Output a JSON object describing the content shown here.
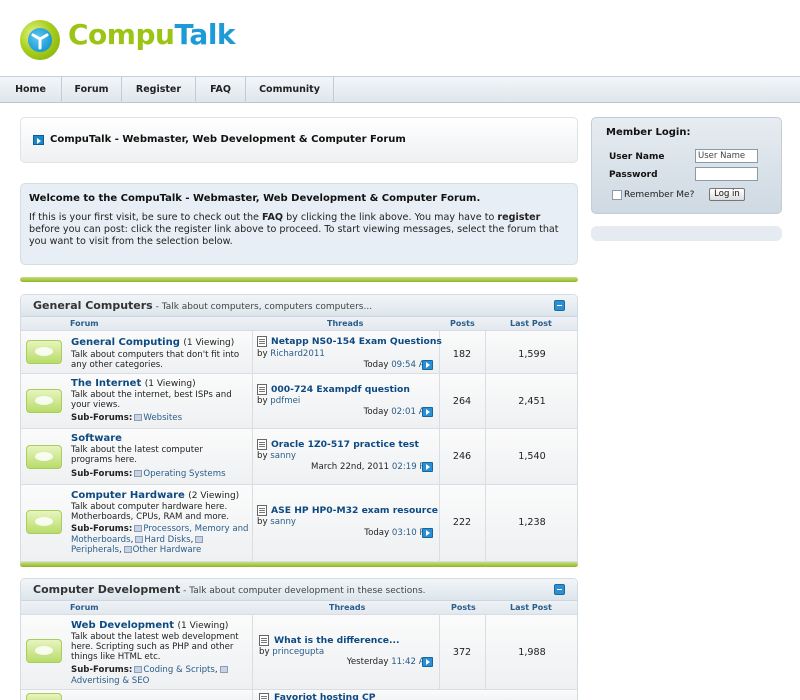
{
  "logo": {
    "part1": "Compu",
    "part2": "Talk"
  },
  "nav": [
    "Home",
    "Forum",
    "Register",
    "FAQ",
    "Community"
  ],
  "page_title": "CompuTalk - Webmaster, Web Development & Computer Forum",
  "welcome": {
    "title": "Welcome to the CompuTalk - Webmaster, Web Development & Computer Forum.",
    "t1": "If this is your first visit, be sure to check out the ",
    "faq": "FAQ",
    "t2": " by clicking the link above. You may have to ",
    "register": "register",
    "t3": " before you can post: click the register link above to proceed. To start viewing messages, select the forum that you want to visit from the selection below."
  },
  "columns": {
    "forum": "Forum",
    "threads": "Threads",
    "posts": "Posts",
    "last_post": "Last Post"
  },
  "subforums_label": "Sub-Forums:",
  "categories": [
    {
      "name": "General Computers",
      "desc": " - Talk about computers, computers computers...",
      "forums": [
        {
          "name": "General Computing",
          "viewing": "(1 Viewing)",
          "desc": "Talk about computers that don't fit into any other categories.",
          "subs": [],
          "thread": "Netapp NS0-154 Exam Questions",
          "by": "by",
          "user": "Richard2011",
          "date": "Today",
          "time": "09:54 AM",
          "threads": "182",
          "posts": "1,599"
        },
        {
          "name": "The Internet",
          "viewing": "(1 Viewing)",
          "desc": "Talk about the internet, best ISPs and your views.",
          "subs": [
            "Websites"
          ],
          "thread": "000-724 Exampdf question",
          "by": "by",
          "user": "pdfmei",
          "date": "Today",
          "time": "02:01 AM",
          "threads": "264",
          "posts": "2,451"
        },
        {
          "name": "Software",
          "viewing": "",
          "desc": "Talk about the latest computer programs here.",
          "subs": [
            "Operating Systems"
          ],
          "thread": "Oracle 1Z0-517 practice test",
          "by": "by",
          "user": "sanny",
          "date": "March 22nd, 2011",
          "time": "02:19 PM",
          "threads": "246",
          "posts": "1,540"
        },
        {
          "name": "Computer Hardware",
          "viewing": "(2 Viewing)",
          "desc": "Talk about computer hardware here. Motherboards, CPUs, RAM and more.",
          "subs": [
            "Processors, Memory and Motherboards",
            "Hard Disks",
            "Peripherals",
            "Other Hardware"
          ],
          "thread": "ASE HP HP0-M32 exam resource",
          "by": "by",
          "user": "sanny",
          "date": "Today",
          "time": "03:10 PM",
          "threads": "222",
          "posts": "1,238"
        }
      ]
    },
    {
      "name": "Computer Development",
      "desc": " - Talk about computer development in these sections.",
      "forums": [
        {
          "name": "Web Development",
          "viewing": "(1 Viewing)",
          "desc": "Talk about the latest web development here. Scripting such as PHP and other things like HTML etc.",
          "subs": [
            "Coding & Scripts",
            "Advertising & SEO"
          ],
          "thread": "What is the difference...",
          "by": "by",
          "user": "princegupta",
          "date": "Yesterday",
          "time": "11:42 AM",
          "threads": "372",
          "posts": "1,988"
        }
      ],
      "next_thread": "Favoriot hosting CP"
    }
  ],
  "login": {
    "title": "Member Login:",
    "user_label": "User Name",
    "user_value": "User Name",
    "pass_label": "Password",
    "remember": "Remember Me?",
    "button": "Log in"
  },
  "colors": {
    "accent_green": "#9cc414",
    "accent_blue": "#1e9ad6",
    "link": "#0d4a82"
  }
}
